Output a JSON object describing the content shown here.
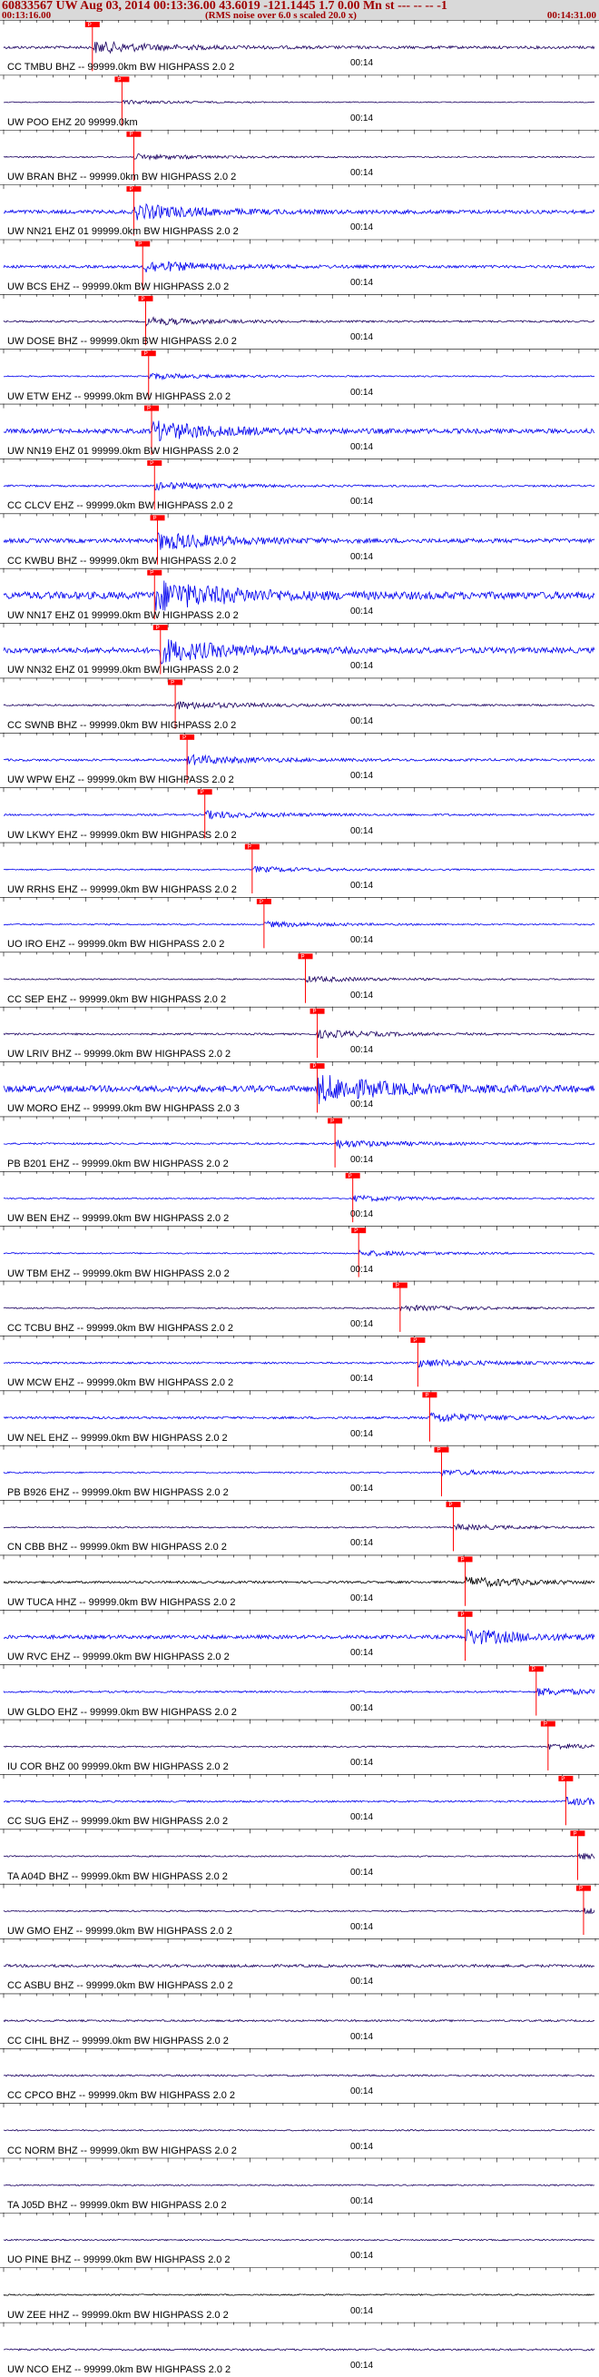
{
  "header": {
    "title": "60833567 UW Aug 03, 2014 00:13:36.00   43.6019 -121.1445  1.7 0.00 Mn st --- -- --  -1",
    "start_time": "00:13:16.00",
    "note": "(RMS noise over 6.0 s scaled 20.0 x)",
    "end_time": "00:14:31.00"
  },
  "colors": {
    "trace_dark": "#1a0060",
    "trace_blue": "#0000ee",
    "trace_black": "#000000",
    "pick": "#ff0000",
    "header_text": "#a00000"
  },
  "tick_label": "00:14",
  "pick_tag": "P",
  "traces": [
    {
      "label": "CC TMBU BHZ -- 99999.0km BW  HIGHPASS  2.0  2",
      "color": "dark",
      "amp": 6,
      "pick": 0.15
    },
    {
      "label": "UW POO EHZ 20 99999.0km",
      "color": "dark",
      "amp": 2,
      "pick": 0.2
    },
    {
      "label": "UW BRAN BHZ -- 99999.0km BW  HIGHPASS  2.0  2",
      "color": "dark",
      "amp": 3,
      "pick": 0.22
    },
    {
      "label": "UW NN21 EHZ 01 99999.0km BW  HIGHPASS  2.0  2",
      "color": "blue",
      "amp": 8,
      "pick": 0.22
    },
    {
      "label": "UW BCS EHZ -- 99999.0km BW  HIGHPASS  2.0  2",
      "color": "blue",
      "amp": 6,
      "pick": 0.235
    },
    {
      "label": "UW DOSE BHZ -- 99999.0km BW  HIGHPASS  2.0  2",
      "color": "dark",
      "amp": 4,
      "pick": 0.24
    },
    {
      "label": "UW ETW EHZ -- 99999.0km BW  HIGHPASS  2.0  2",
      "color": "blue",
      "amp": 3,
      "pick": 0.245
    },
    {
      "label": "UW NN19 EHZ 01 99999.0km BW  HIGHPASS  2.0  2",
      "color": "blue",
      "amp": 10,
      "pick": 0.25
    },
    {
      "label": "CC CLCV EHZ -- 99999.0km BW  HIGHPASS  2.0  2",
      "color": "blue",
      "amp": 4,
      "pick": 0.255
    },
    {
      "label": "CC KWBU BHZ -- 99999.0km BW  HIGHPASS  2.0  2",
      "color": "blue",
      "amp": 9,
      "pick": 0.26
    },
    {
      "label": "UW NN17 EHZ 01 99999.0km BW  HIGHPASS  2.0  2",
      "color": "blue",
      "amp": 16,
      "pick": 0.255
    },
    {
      "label": "UW NN32 EHZ 01 99999.0km BW  HIGHPASS  2.0  2",
      "color": "blue",
      "amp": 12,
      "pick": 0.265
    },
    {
      "label": "CC SWNB BHZ -- 99999.0km BW  HIGHPASS  2.0  2",
      "color": "dark",
      "amp": 4,
      "pick": 0.29
    },
    {
      "label": "UW WPW EHZ -- 99999.0km BW  HIGHPASS  2.0  2",
      "color": "blue",
      "amp": 5,
      "pick": 0.31
    },
    {
      "label": "UW LKWY EHZ -- 99999.0km BW  HIGHPASS  2.0  2",
      "color": "blue",
      "amp": 4,
      "pick": 0.34
    },
    {
      "label": "UW RRHS EHZ -- 99999.0km BW  HIGHPASS  2.0  2",
      "color": "blue",
      "amp": 3,
      "pick": 0.42
    },
    {
      "label": "UO IRO EHZ -- 99999.0km BW  HIGHPASS  2.0  2",
      "color": "blue",
      "amp": 3,
      "pick": 0.44
    },
    {
      "label": "CC SEP EHZ -- 99999.0km BW  HIGHPASS  2.0  2",
      "color": "dark",
      "amp": 3,
      "pick": 0.51
    },
    {
      "label": "UW LRIV BHZ -- 99999.0km BW  HIGHPASS  2.0  2",
      "color": "dark",
      "amp": 4,
      "pick": 0.53
    },
    {
      "label": "UW MORO EHZ -- 99999.0km BW  HIGHPASS  2.0  3",
      "color": "blue",
      "amp": 14,
      "pick": 0.53
    },
    {
      "label": "PB B201 EHZ -- 99999.0km BW  HIGHPASS  2.0  2",
      "color": "blue",
      "amp": 4,
      "pick": 0.56
    },
    {
      "label": "UW BEN EHZ -- 99999.0km BW  HIGHPASS  2.0  2",
      "color": "blue",
      "amp": 3,
      "pick": 0.59
    },
    {
      "label": "UW TBM EHZ -- 99999.0km BW  HIGHPASS  2.0  2",
      "color": "blue",
      "amp": 3,
      "pick": 0.6
    },
    {
      "label": "CC TCBU BHZ -- 99999.0km BW  HIGHPASS  2.0  2",
      "color": "dark",
      "amp": 3,
      "pick": 0.67
    },
    {
      "label": "UW MCW EHZ -- 99999.0km BW  HIGHPASS  2.0  2",
      "color": "blue",
      "amp": 4,
      "pick": 0.7
    },
    {
      "label": "UW NEL EHZ -- 99999.0km BW  HIGHPASS  2.0  2",
      "color": "blue",
      "amp": 5,
      "pick": 0.72
    },
    {
      "label": "PB B926 EHZ -- 99999.0km BW  HIGHPASS  2.0  2",
      "color": "blue",
      "amp": 3,
      "pick": 0.74
    },
    {
      "label": "CN CBB BHZ -- 99999.0km BW  HIGHPASS  2.0  2",
      "color": "dark",
      "amp": 3,
      "pick": 0.76
    },
    {
      "label": "UW TUCA HHZ -- 99999.0km BW  HIGHPASS  2.0  2",
      "color": "black",
      "amp": 5,
      "pick": 0.78
    },
    {
      "label": "UW RVC EHZ -- 99999.0km BW  HIGHPASS  2.0  2",
      "color": "blue",
      "amp": 8,
      "pick": 0.78
    },
    {
      "label": "UW GLDO EHZ -- 99999.0km BW  HIGHPASS  2.0  2",
      "color": "blue",
      "amp": 4,
      "pick": 0.9
    },
    {
      "label": "IU COR BHZ 00 99999.0km BW  HIGHPASS  2.0  2",
      "color": "dark",
      "amp": 3,
      "pick": 0.92
    },
    {
      "label": "CC SUG EHZ -- 99999.0km BW  HIGHPASS  2.0  2",
      "color": "blue",
      "amp": 4,
      "pick": 0.95
    },
    {
      "label": "TA A04D BHZ -- 99999.0km BW  HIGHPASS  2.0  2",
      "color": "dark",
      "amp": 3,
      "pick": 0.97
    },
    {
      "label": "UW GMO EHZ -- 99999.0km BW  HIGHPASS  2.0  2",
      "color": "dark",
      "amp": 3,
      "pick": 0.98
    },
    {
      "label": "CC ASBU BHZ -- 99999.0km BW  HIGHPASS  2.0  2",
      "color": "dark",
      "amp": 6,
      "pick": null
    },
    {
      "label": "CC CIHL BHZ -- 99999.0km BW  HIGHPASS  2.0  2",
      "color": "dark",
      "amp": 4,
      "pick": null
    },
    {
      "label": "CC CPCO BHZ -- 99999.0km BW  HIGHPASS  2.0  2",
      "color": "dark",
      "amp": 4,
      "pick": null
    },
    {
      "label": "CC NORM BHZ -- 99999.0km BW  HIGHPASS  2.0  2",
      "color": "dark",
      "amp": 3,
      "pick": null
    },
    {
      "label": "TA J05D BHZ -- 99999.0km BW  HIGHPASS  2.0  2",
      "color": "dark",
      "amp": 3,
      "pick": null
    },
    {
      "label": "UO PINE BHZ -- 99999.0km BW  HIGHPASS  2.0  2",
      "color": "dark",
      "amp": 3,
      "pick": null
    },
    {
      "label": "UW ZEE HHZ -- 99999.0km BW  HIGHPASS  2.0  2",
      "color": "black",
      "amp": 3,
      "pick": null
    },
    {
      "label": "UW NCO EHZ -- 99999.0km BW  HIGHPASS  2.0  2",
      "color": "dark",
      "amp": 4,
      "pick": null
    }
  ]
}
